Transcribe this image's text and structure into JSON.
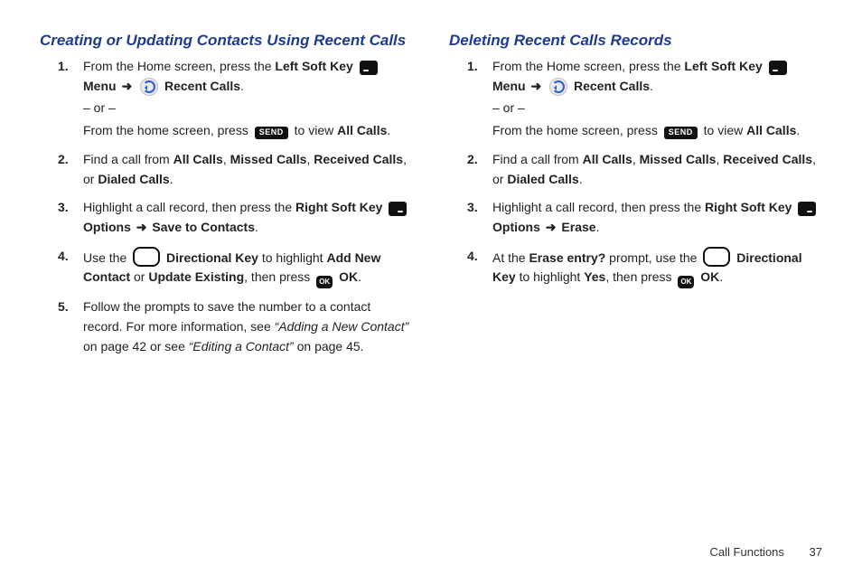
{
  "left": {
    "heading": "Creating or Updating Contacts Using Recent Calls",
    "steps": {
      "s1": {
        "a1": "From the Home screen, press the ",
        "a2": "Left Soft Key",
        "a3": "Menu",
        "a4": "Recent Calls",
        "or": "– or –",
        "b1": "From the home screen, press ",
        "b2": " to view ",
        "b3": "All Calls",
        "b4": "."
      },
      "s2": {
        "a1": "Find a call from ",
        "b1": "All Calls",
        "a2": ", ",
        "b2": "Missed Calls",
        "a3": ", ",
        "b3": "Received Calls",
        "a4": ", or ",
        "b4": "Dialed Calls",
        "a5": "."
      },
      "s3": {
        "a1": "Highlight a call record, then press the ",
        "b1": "Right Soft Key",
        "b2": "Options",
        "b3": "Save to Contacts",
        "a2": "."
      },
      "s4": {
        "a1": "Use the ",
        "b1": "Directional Key",
        "a2": " to highlight ",
        "b2": "Add New Contact",
        "a3": " or ",
        "b3": "Update Existing",
        "a4": ", then press ",
        "b4": "OK",
        "a5": "."
      },
      "s5": {
        "a1": "Follow the prompts to save the number to a contact record. For more information, see ",
        "q1": "“Adding a New Contact”",
        "a2": " on page 42 or see ",
        "q2": "“Editing a Contact”",
        "a3": " on page 45."
      }
    }
  },
  "right": {
    "heading": "Deleting Recent Calls Records",
    "steps": {
      "s1": {
        "a1": "From the Home screen, press the ",
        "a2": "Left Soft Key",
        "a3": "Menu",
        "a4": "Recent Calls",
        "or": "– or –",
        "b1": "From the home screen, press ",
        "b2": " to view ",
        "b3": "All Calls",
        "b4": "."
      },
      "s2": {
        "a1": "Find a call from ",
        "b1": "All Calls",
        "a2": ", ",
        "b2": "Missed Calls",
        "a3": ", ",
        "b3": "Received Calls",
        "a4": ", or ",
        "b4": "Dialed Calls",
        "a5": "."
      },
      "s3": {
        "a1": "Highlight a call record, then press the ",
        "b1": "Right Soft Key",
        "b2": "Options",
        "b3": "Erase",
        "a2": "."
      },
      "s4": {
        "a1": "At the ",
        "b1": "Erase entry?",
        "a2": " prompt, use the ",
        "b2": "Directional Key",
        "a3": " to highlight ",
        "b3": "Yes",
        "a4": ", then press ",
        "b4": "OK",
        "a5": "."
      }
    }
  },
  "icons": {
    "send": "SEND",
    "ok": "OK",
    "arrow": "➜"
  },
  "footer": {
    "section": "Call Functions",
    "page": "37"
  }
}
